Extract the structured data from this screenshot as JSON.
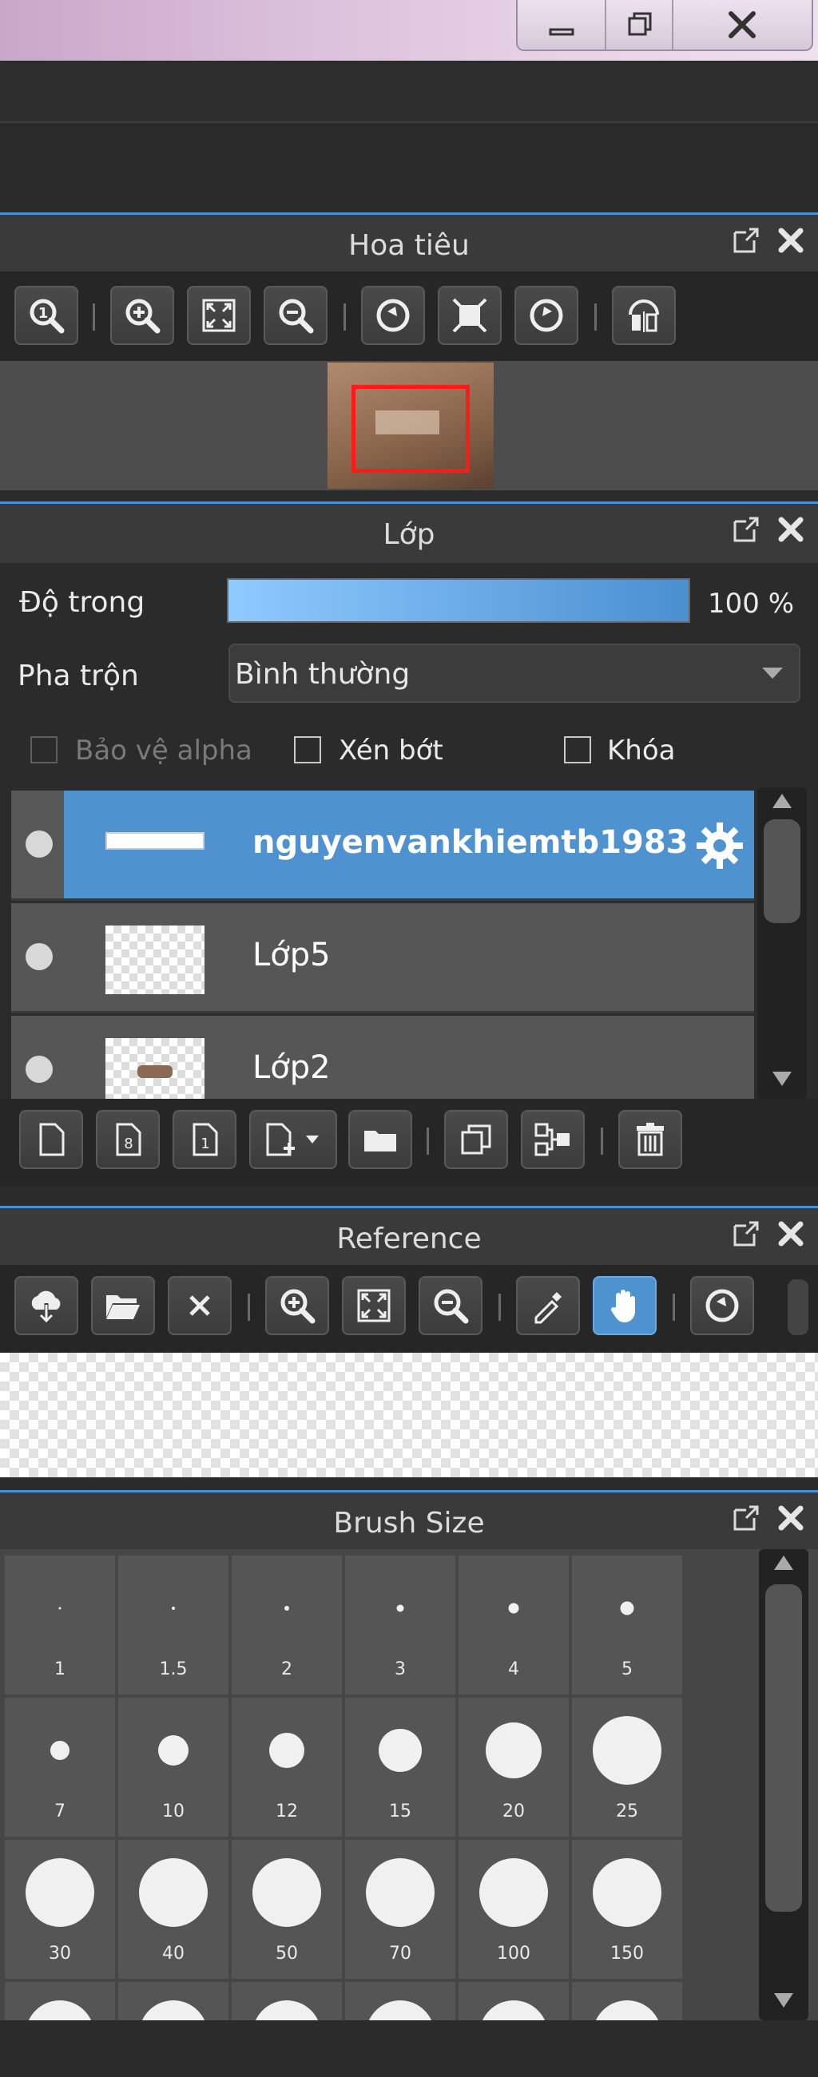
{
  "window": {
    "minimize_label": "minimize",
    "restore_label": "restore",
    "close_label": "close"
  },
  "navigator": {
    "title": "Hoa tiêu",
    "tools": [
      "zoom-actual-icon",
      "zoom-in-icon",
      "fit-view-icon",
      "zoom-out-icon",
      "rotate-left-icon",
      "fullscreen-icon",
      "rotate-right-icon",
      "flip-icon"
    ]
  },
  "layers": {
    "title": "Lớp",
    "opacity_label": "Độ trong",
    "opacity_value": "100 %",
    "opacity_fraction": 1.0,
    "blend_label": "Pha trộn",
    "blend_value": "Bình thường",
    "protect_alpha_label": "Bảo vệ alpha",
    "clipping_label": "Xén bớt",
    "lock_label": "Khóa",
    "items": [
      {
        "name": "nguyenvankhiemtb1983"
      },
      {
        "name": "Lớp5"
      },
      {
        "name": "Lớp2"
      }
    ],
    "tools": [
      "new-layer-icon",
      "new-8bit-layer-icon",
      "new-1bit-layer-icon",
      "add-layer-menu-icon",
      "new-folder-icon",
      "duplicate-icon",
      "merge-icon",
      "delete-icon"
    ]
  },
  "reference": {
    "title": "Reference",
    "tools": [
      "load-cloud-icon",
      "open-folder-icon",
      "close-icon",
      "zoom-in-icon",
      "fit-view-icon",
      "zoom-out-icon",
      "eyedropper-icon",
      "hand-icon",
      "rotate-icon"
    ]
  },
  "brush_size": {
    "title": "Brush Size",
    "sizes": [
      {
        "label": "1",
        "d": 3
      },
      {
        "label": "1.5",
        "d": 4
      },
      {
        "label": "2",
        "d": 6
      },
      {
        "label": "3",
        "d": 9
      },
      {
        "label": "4",
        "d": 13
      },
      {
        "label": "5",
        "d": 17
      },
      {
        "label": "7",
        "d": 24
      },
      {
        "label": "10",
        "d": 38
      },
      {
        "label": "12",
        "d": 44
      },
      {
        "label": "15",
        "d": 54
      },
      {
        "label": "20",
        "d": 70
      },
      {
        "label": "25",
        "d": 86
      },
      {
        "label": "30",
        "d": 86
      },
      {
        "label": "40",
        "d": 86
      },
      {
        "label": "50",
        "d": 86
      },
      {
        "label": "70",
        "d": 86
      },
      {
        "label": "100",
        "d": 86
      },
      {
        "label": "150",
        "d": 86
      }
    ]
  },
  "colors": {
    "accent": "#4a90d9",
    "selected_layer": "#4e93d0",
    "active_tool": "#4e93d0",
    "selection_frame": "#ff1a1a"
  }
}
